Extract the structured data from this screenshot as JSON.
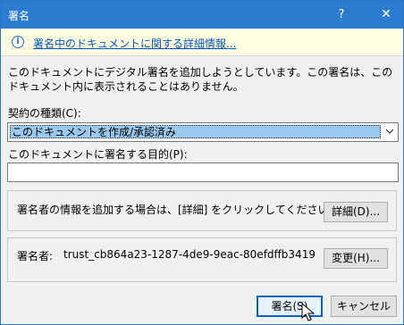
{
  "window": {
    "title": "署名",
    "help": "?",
    "close": "✕"
  },
  "infobar": {
    "icon": "info-icon",
    "link": "署名中のドキュメントに関する詳細情報..."
  },
  "description": "このドキュメントにデジタル署名を追加しようとしています。この署名は、このドキュメント内に表示されることはありません。",
  "commitment": {
    "label": "契約の種類(C):",
    "value": "このドキュメントを作成/承認済み"
  },
  "purpose": {
    "label": "このドキュメントに署名する目的(P):",
    "value": ""
  },
  "signer_info": {
    "text": "署名者の情報を追加する場合は、[詳細] をクリックしてください。",
    "button": "詳細(D)..."
  },
  "signer": {
    "label": "署名者:",
    "name": "trust_cb864a23-1287-4de9-9eac-80efdffb3419",
    "button": "変更(H)..."
  },
  "footer": {
    "sign": "署名(S)",
    "cancel": "キャンセル"
  }
}
